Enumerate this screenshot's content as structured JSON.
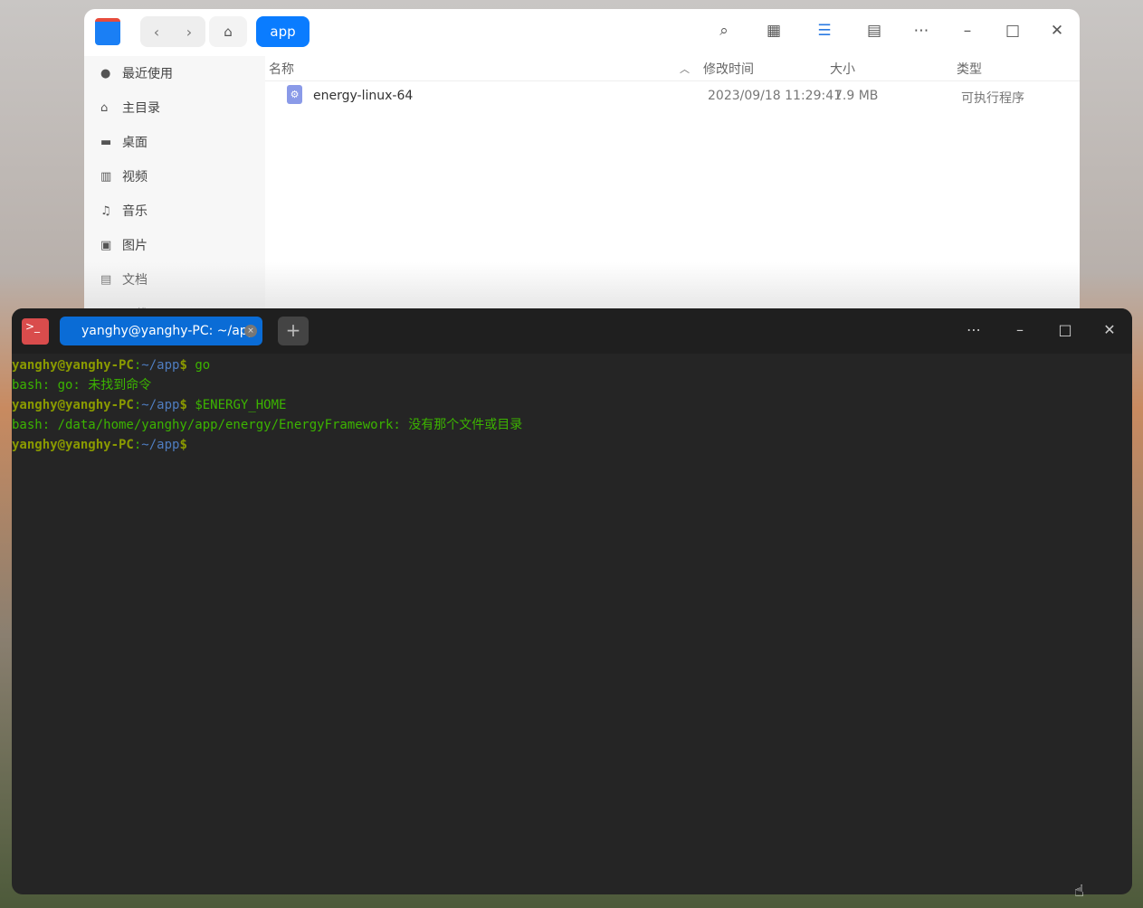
{
  "file_manager": {
    "breadcrumb": "app",
    "sidebar": [
      "最近使用",
      "主目录",
      "桌面",
      "视频",
      "音乐",
      "图片",
      "文档",
      "下载"
    ],
    "columns": {
      "name": "名称",
      "modified": "修改时间",
      "size": "大小",
      "type": "类型"
    },
    "files": [
      {
        "name": "energy-linux-64",
        "modified": "2023/09/18 11:29:41",
        "size": "7.9 MB",
        "type": "可执行程序"
      }
    ]
  },
  "terminal": {
    "tab_title": "yanghy@yanghy-PC: ~/app",
    "prompt_user": "yanghy@yanghy-PC",
    "prompt_path": "~/app",
    "lines": [
      {
        "cmd": "go"
      },
      {
        "out": "bash: go: 未找到命令"
      },
      {
        "cmd": "$ENERGY_HOME"
      },
      {
        "out": "bash: /data/home/yanghy/app/energy/EnergyFramework: 没有那个文件或目录"
      },
      {
        "cmd": ""
      }
    ]
  }
}
